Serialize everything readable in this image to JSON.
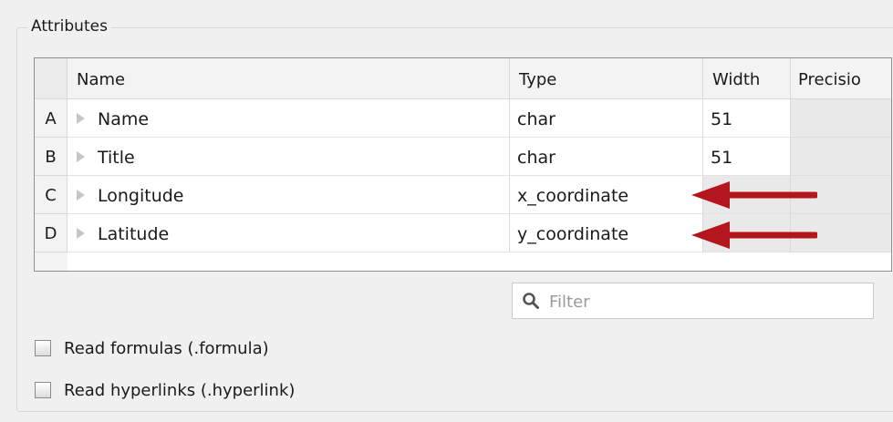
{
  "group": {
    "title": "Attributes"
  },
  "table": {
    "headers": {
      "name": "Name",
      "type": "Type",
      "width": "Width",
      "precision": "Precisio"
    },
    "rows": [
      {
        "id": "A",
        "name": "Name",
        "type": "char",
        "width": "51",
        "precision": ""
      },
      {
        "id": "B",
        "name": "Title",
        "type": "char",
        "width": "51",
        "precision": ""
      },
      {
        "id": "C",
        "name": "Longitude",
        "type": "x_coordinate",
        "width": "",
        "precision": ""
      },
      {
        "id": "D",
        "name": "Latitude",
        "type": "y_coordinate",
        "width": "",
        "precision": ""
      }
    ]
  },
  "filter": {
    "placeholder": "Filter",
    "value": ""
  },
  "options": {
    "read_formulas": {
      "label": "Read formulas (.formula)",
      "checked": false
    },
    "read_hyperlinks": {
      "label": "Read hyperlinks (.hyperlink)",
      "checked": false
    }
  },
  "colors": {
    "annotation_arrow": "#b3161c"
  }
}
